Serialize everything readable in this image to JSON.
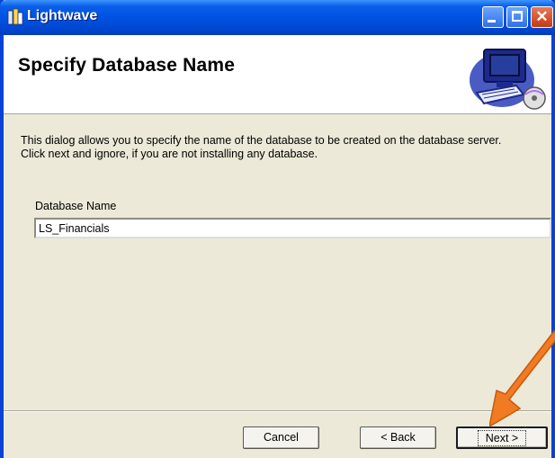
{
  "window": {
    "title": "Lightwave",
    "controls": [
      "minimize-icon",
      "maximize-icon",
      "close-icon"
    ]
  },
  "header": {
    "title": "Specify Database Name",
    "icon": "computer-setup-icon"
  },
  "description": {
    "line1": "This dialog allows you to specify the name of the database to be created on the database server.",
    "line2": "Click next and ignore, if you are not installing any database."
  },
  "database_field": {
    "label": "Database Name",
    "value": "LS_Financials"
  },
  "buttons": {
    "cancel": "Cancel",
    "back": "< Back",
    "next": "Next >"
  },
  "colors": {
    "titlebar": "#0054e3",
    "dialog_bg": "#ece9d8",
    "arrow": "#f07b22"
  }
}
